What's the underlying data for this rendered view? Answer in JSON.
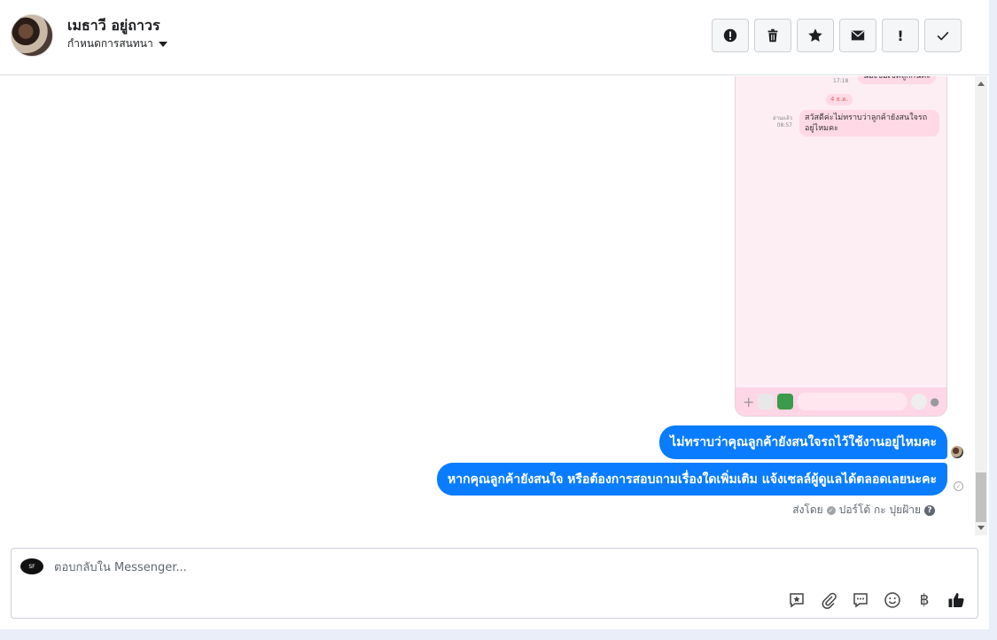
{
  "header": {
    "name": "เมธาวี อยู่ถาวร",
    "assign_label": "กำหนดการสนทนา",
    "toolbar": [
      {
        "name": "alert-circle-icon"
      },
      {
        "name": "trash-icon"
      },
      {
        "name": "star-icon"
      },
      {
        "name": "envelope-icon"
      },
      {
        "name": "exclamation-icon",
        "label": "!"
      },
      {
        "name": "check-icon"
      }
    ]
  },
  "screenshot": {
    "bubble_top": "น้องขอเช็คลูกกันคะ",
    "time_top": "17:18",
    "date_chip": "4 ธ.ค.",
    "bubble_main": "สวัสดีค่ะไม่ทราบว่าลูกค้ายังสนใจรถอยู่ไหมคะ",
    "read_label": "อ่านแล้ว",
    "time_main": "08:57"
  },
  "messages": [
    {
      "text": "ไม่ทราบว่าคุณลูกค้ายังสนใจรถไว้ใช้งานอยู่ไหมคะ"
    },
    {
      "text": "หากคุณลูกค้ายังสนใจ หรือต้องการสอบถามเรื่องใดเพิ่มเติม แจ้งเซลล์ผู้ดูแลได้ตลอดเลยนะคะ"
    }
  ],
  "sent_by": {
    "prefix": "ส่งโดย",
    "name": "ปอร์โต้ กะ ปุยฝ้าย",
    "help": "?"
  },
  "composer": {
    "placeholder": "ตอบกลับใน Messenger...",
    "baht": "฿"
  },
  "colors": {
    "message_blue": "#0a7cff",
    "phone_bg": "#fdeef4"
  }
}
